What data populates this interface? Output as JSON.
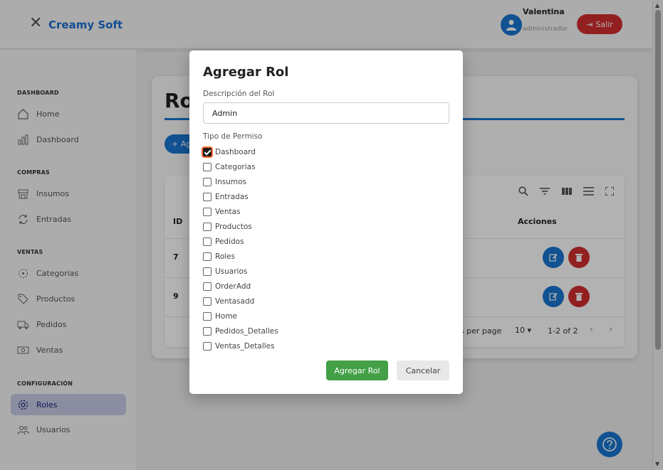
{
  "header": {
    "brand": "Creamy Soft",
    "user_name": "Valentina",
    "user_role": "administrador",
    "logout_label": "Salir"
  },
  "sidebar": {
    "sections": [
      {
        "title": "DASHBOARD",
        "items": [
          {
            "label": "Home",
            "icon": "home-icon"
          },
          {
            "label": "Dashboard",
            "icon": "bar-chart-icon"
          }
        ]
      },
      {
        "title": "COMPRAS",
        "items": [
          {
            "label": "Insumos",
            "icon": "store-icon"
          },
          {
            "label": "Entradas",
            "icon": "refresh-icon"
          }
        ]
      },
      {
        "title": "VENTAS",
        "items": [
          {
            "label": "Categorias",
            "icon": "category-icon"
          },
          {
            "label": "Productos",
            "icon": "tag-icon"
          },
          {
            "label": "Pedidos",
            "icon": "truck-icon"
          },
          {
            "label": "Ventas",
            "icon": "cash-icon"
          }
        ]
      },
      {
        "title": "CONFIGURACIÓN",
        "items": [
          {
            "label": "Roles",
            "icon": "gear-icon",
            "active": true
          },
          {
            "label": "Usuarios",
            "icon": "users-icon"
          }
        ]
      }
    ]
  },
  "main": {
    "title": "Roles",
    "add_button": "+ Agregar",
    "table": {
      "col_id": "ID",
      "col_actions": "Acciones",
      "rows": [
        {
          "id": "7"
        },
        {
          "id": "9"
        }
      ],
      "rows_per_page_label": "Rows per page",
      "rows_per_page_value": "10",
      "range": "1-2 of 2"
    }
  },
  "modal": {
    "title": "Agregar Rol",
    "desc_label": "Descripción del Rol",
    "desc_value": "Admin",
    "perm_label": "Tipo de Permiso",
    "permissions": [
      {
        "label": "Dashboard",
        "checked": true
      },
      {
        "label": "Categorias",
        "checked": false
      },
      {
        "label": "Insumos",
        "checked": false
      },
      {
        "label": "Entradas",
        "checked": false
      },
      {
        "label": "Ventas",
        "checked": false
      },
      {
        "label": "Productos",
        "checked": false
      },
      {
        "label": "Pedidos",
        "checked": false
      },
      {
        "label": "Roles",
        "checked": false
      },
      {
        "label": "Usuarios",
        "checked": false
      },
      {
        "label": "OrderAdd",
        "checked": false
      },
      {
        "label": "Ventasadd",
        "checked": false
      },
      {
        "label": "Home",
        "checked": false
      },
      {
        "label": "Pedidos_Detalles",
        "checked": false
      },
      {
        "label": "Ventas_Detalles",
        "checked": false
      }
    ],
    "submit_label": "Agregar Rol",
    "cancel_label": "Cancelar"
  },
  "colors": {
    "brand": "#1e6fd0",
    "primary": "#1976d2",
    "danger": "#d32f2f",
    "success": "#43a047",
    "active_nav": "#c7cbe6"
  }
}
